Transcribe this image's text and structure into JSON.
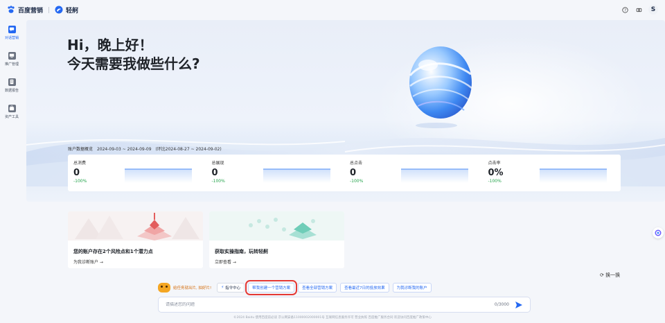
{
  "brand": {
    "name": "百度营销",
    "product": "轻舸"
  },
  "topbar": {
    "avatar_letter": "S"
  },
  "sidebar": {
    "items": [
      {
        "label": "对话营销",
        "icon": "chat-icon",
        "active": true
      },
      {
        "label": "推广管理",
        "icon": "monitor-icon",
        "active": false
      },
      {
        "label": "数据报告",
        "icon": "report-icon",
        "active": false
      },
      {
        "label": "资产工具",
        "icon": "toolbox-icon",
        "active": false
      }
    ]
  },
  "hero": {
    "greeting": "Hi，晚上好！",
    "question": "今天需要我做些什么?"
  },
  "overview": {
    "label": "账户数据概览",
    "range": "2024-09-03 ~ 2024-09-09",
    "compare": "(环比2024-08-27 ~ 2024-09-02)",
    "stats": [
      {
        "label": "总消费",
        "value": "0",
        "delta": "-100%"
      },
      {
        "label": "总展现",
        "value": "0",
        "delta": "-100%"
      },
      {
        "label": "总点击",
        "value": "0",
        "delta": "-100%"
      },
      {
        "label": "点击率",
        "value": "0%",
        "delta": "-100%"
      }
    ]
  },
  "cards": [
    {
      "title": "您的账户存在2个风险点和1个潜力点",
      "link": "为我诊断账户 →"
    },
    {
      "title": "获取实操指南，玩转轻舸",
      "link": "立即查看 →"
    }
  ],
  "refresh_label": "换一换",
  "assistant": {
    "tip": "给任务就出片, 拍好片!",
    "chips": [
      {
        "label": "指令中心"
      },
      {
        "label": "帮我创建一个营销方案",
        "highlight": true
      },
      {
        "label": "查看全部营销方案"
      },
      {
        "label": "查看最近7日的投放效果"
      },
      {
        "label": "为我诊断我的账户"
      }
    ]
  },
  "input": {
    "placeholder": "请描述您的问题",
    "counter": "0/3000"
  },
  "footer": "©2024 Baidu 使用百度前必读 京公网安备11000002000001号 互联网信息服务许可 营业执照 百度推广服务合同 欢迎访问百度推广政策中心",
  "colors": {
    "accent": "#2468f2",
    "positive": "#22a34a",
    "highlight": "#e53935"
  }
}
